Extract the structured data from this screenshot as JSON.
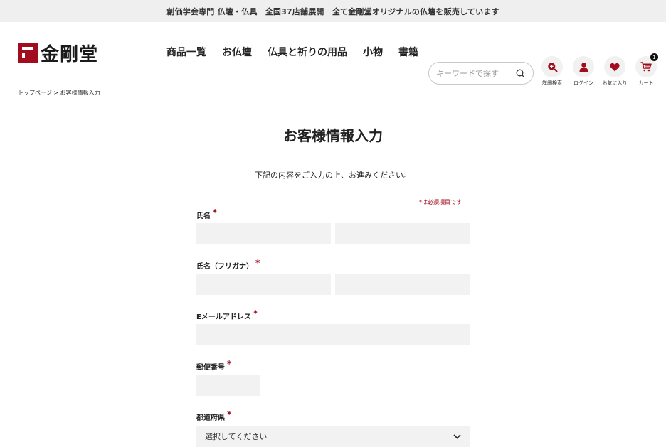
{
  "topbar": {
    "text": "創価学会専門 仏壇・仏具　全国37店舗展開　全て金剛堂オリジナルの仏壇を販売しています"
  },
  "header": {
    "logo_text": "金剛堂",
    "nav": [
      "商品一覧",
      "お仏壇",
      "仏具と祈りの用品",
      "小物",
      "書籍"
    ],
    "search_placeholder": "キーワードで探す",
    "icons": [
      {
        "name": "detail-search-icon",
        "label": "詳細検索"
      },
      {
        "name": "user-icon",
        "label": "ログイン"
      },
      {
        "name": "heart-icon",
        "label": "お気に入り"
      },
      {
        "name": "cart-icon",
        "label": "カート",
        "badge": "1"
      }
    ]
  },
  "breadcrumb": {
    "home": "トップページ",
    "separator": ">",
    "current": "お客様情報入力"
  },
  "page": {
    "title": "お客様情報入力",
    "intro": "下記の内容をご入力の上、お進みください。",
    "required_note": "*は必須項目です"
  },
  "form": {
    "required_mark": "*",
    "name_label": "氏名",
    "kana_label": "氏名（フリガナ）",
    "email_label": "Eメールアドレス",
    "zip_label": "郵便番号",
    "pref_label": "都道府県",
    "pref_value": "選択してください"
  },
  "colors": {
    "accent": "#a10c1f",
    "field_bg": "#f2f2f2",
    "topbar_bg": "#efefef"
  }
}
